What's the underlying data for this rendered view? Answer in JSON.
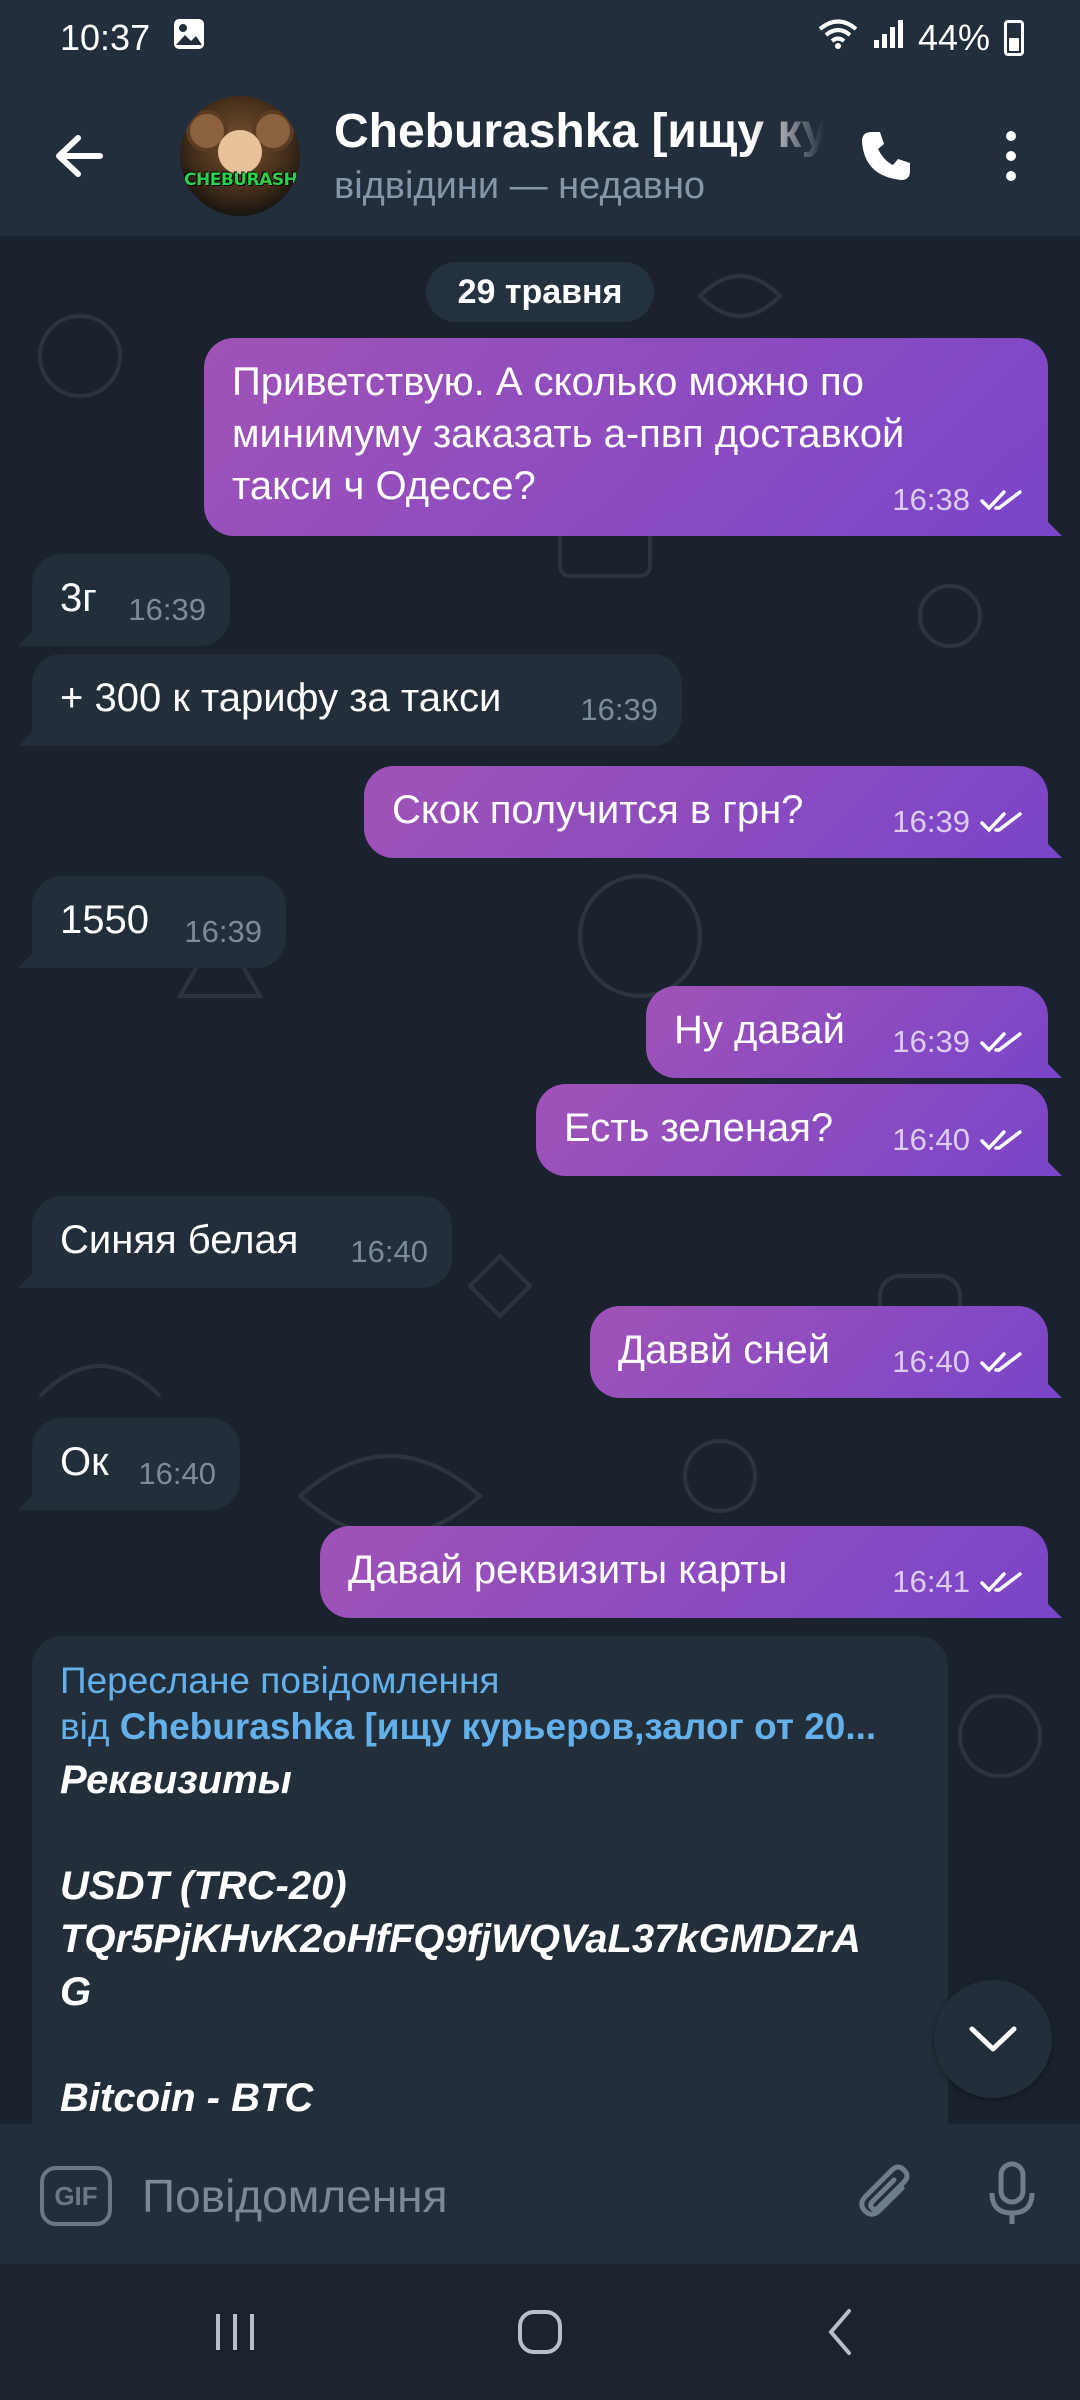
{
  "status_bar": {
    "time": "10:37",
    "battery": "44%",
    "icons": [
      "gallery-icon",
      "wifi-icon",
      "signal-icon",
      "battery-icon"
    ]
  },
  "header": {
    "title": "Cheburashka [ищу ку",
    "subtitle": "відвідини — недавно",
    "avatar_text": "CHEBURASHKA"
  },
  "chat": {
    "date": "29 травня",
    "messages": [
      {
        "dir": "out",
        "text": "Приветствую. А сколько можно по\nминимуму заказать а-пвп доставкой\nтакси ч Одессе?",
        "time": "16:38"
      },
      {
        "dir": "in",
        "text": "3г",
        "time": "16:39"
      },
      {
        "dir": "in",
        "text": "+ 300 к тарифу за такси",
        "time": "16:39"
      },
      {
        "dir": "out",
        "text": "Скок получится в грн?",
        "time": "16:39"
      },
      {
        "dir": "in",
        "text": "1550",
        "time": "16:39"
      },
      {
        "dir": "out",
        "text": "Ну давай",
        "time": "16:39"
      },
      {
        "dir": "out",
        "text": "Есть зеленая?",
        "time": "16:40"
      },
      {
        "dir": "in",
        "text": "Синяя белая",
        "time": "16:40"
      },
      {
        "dir": "out",
        "text": "Даввй сней",
        "time": "16:40"
      },
      {
        "dir": "in",
        "text": "Ок",
        "time": "16:40"
      },
      {
        "dir": "out",
        "text": "Давай реквизиты карты",
        "time": "16:41"
      }
    ],
    "forwarded": {
      "label": "Переслане повідомлення",
      "from_prefix": "від ",
      "from_name": "Cheburashka [ищу курьеров,залог от 20...",
      "body": "Реквизиты\n\nUSDT (TRC-20)\nTQr5PjKHvK2oHfFQ9fjWQVaL37kGMDZrA\nG\n\nBitcoin - BTC"
    }
  },
  "input": {
    "gif_label": "GIF",
    "placeholder": "Повідомлення"
  },
  "colors": {
    "header_bg": "#232e3c",
    "chat_bg": "#1a232d",
    "outgoing_bubble": "#8a4cc0",
    "incoming_bubble": "#232e3b",
    "link": "#64b0ea"
  }
}
